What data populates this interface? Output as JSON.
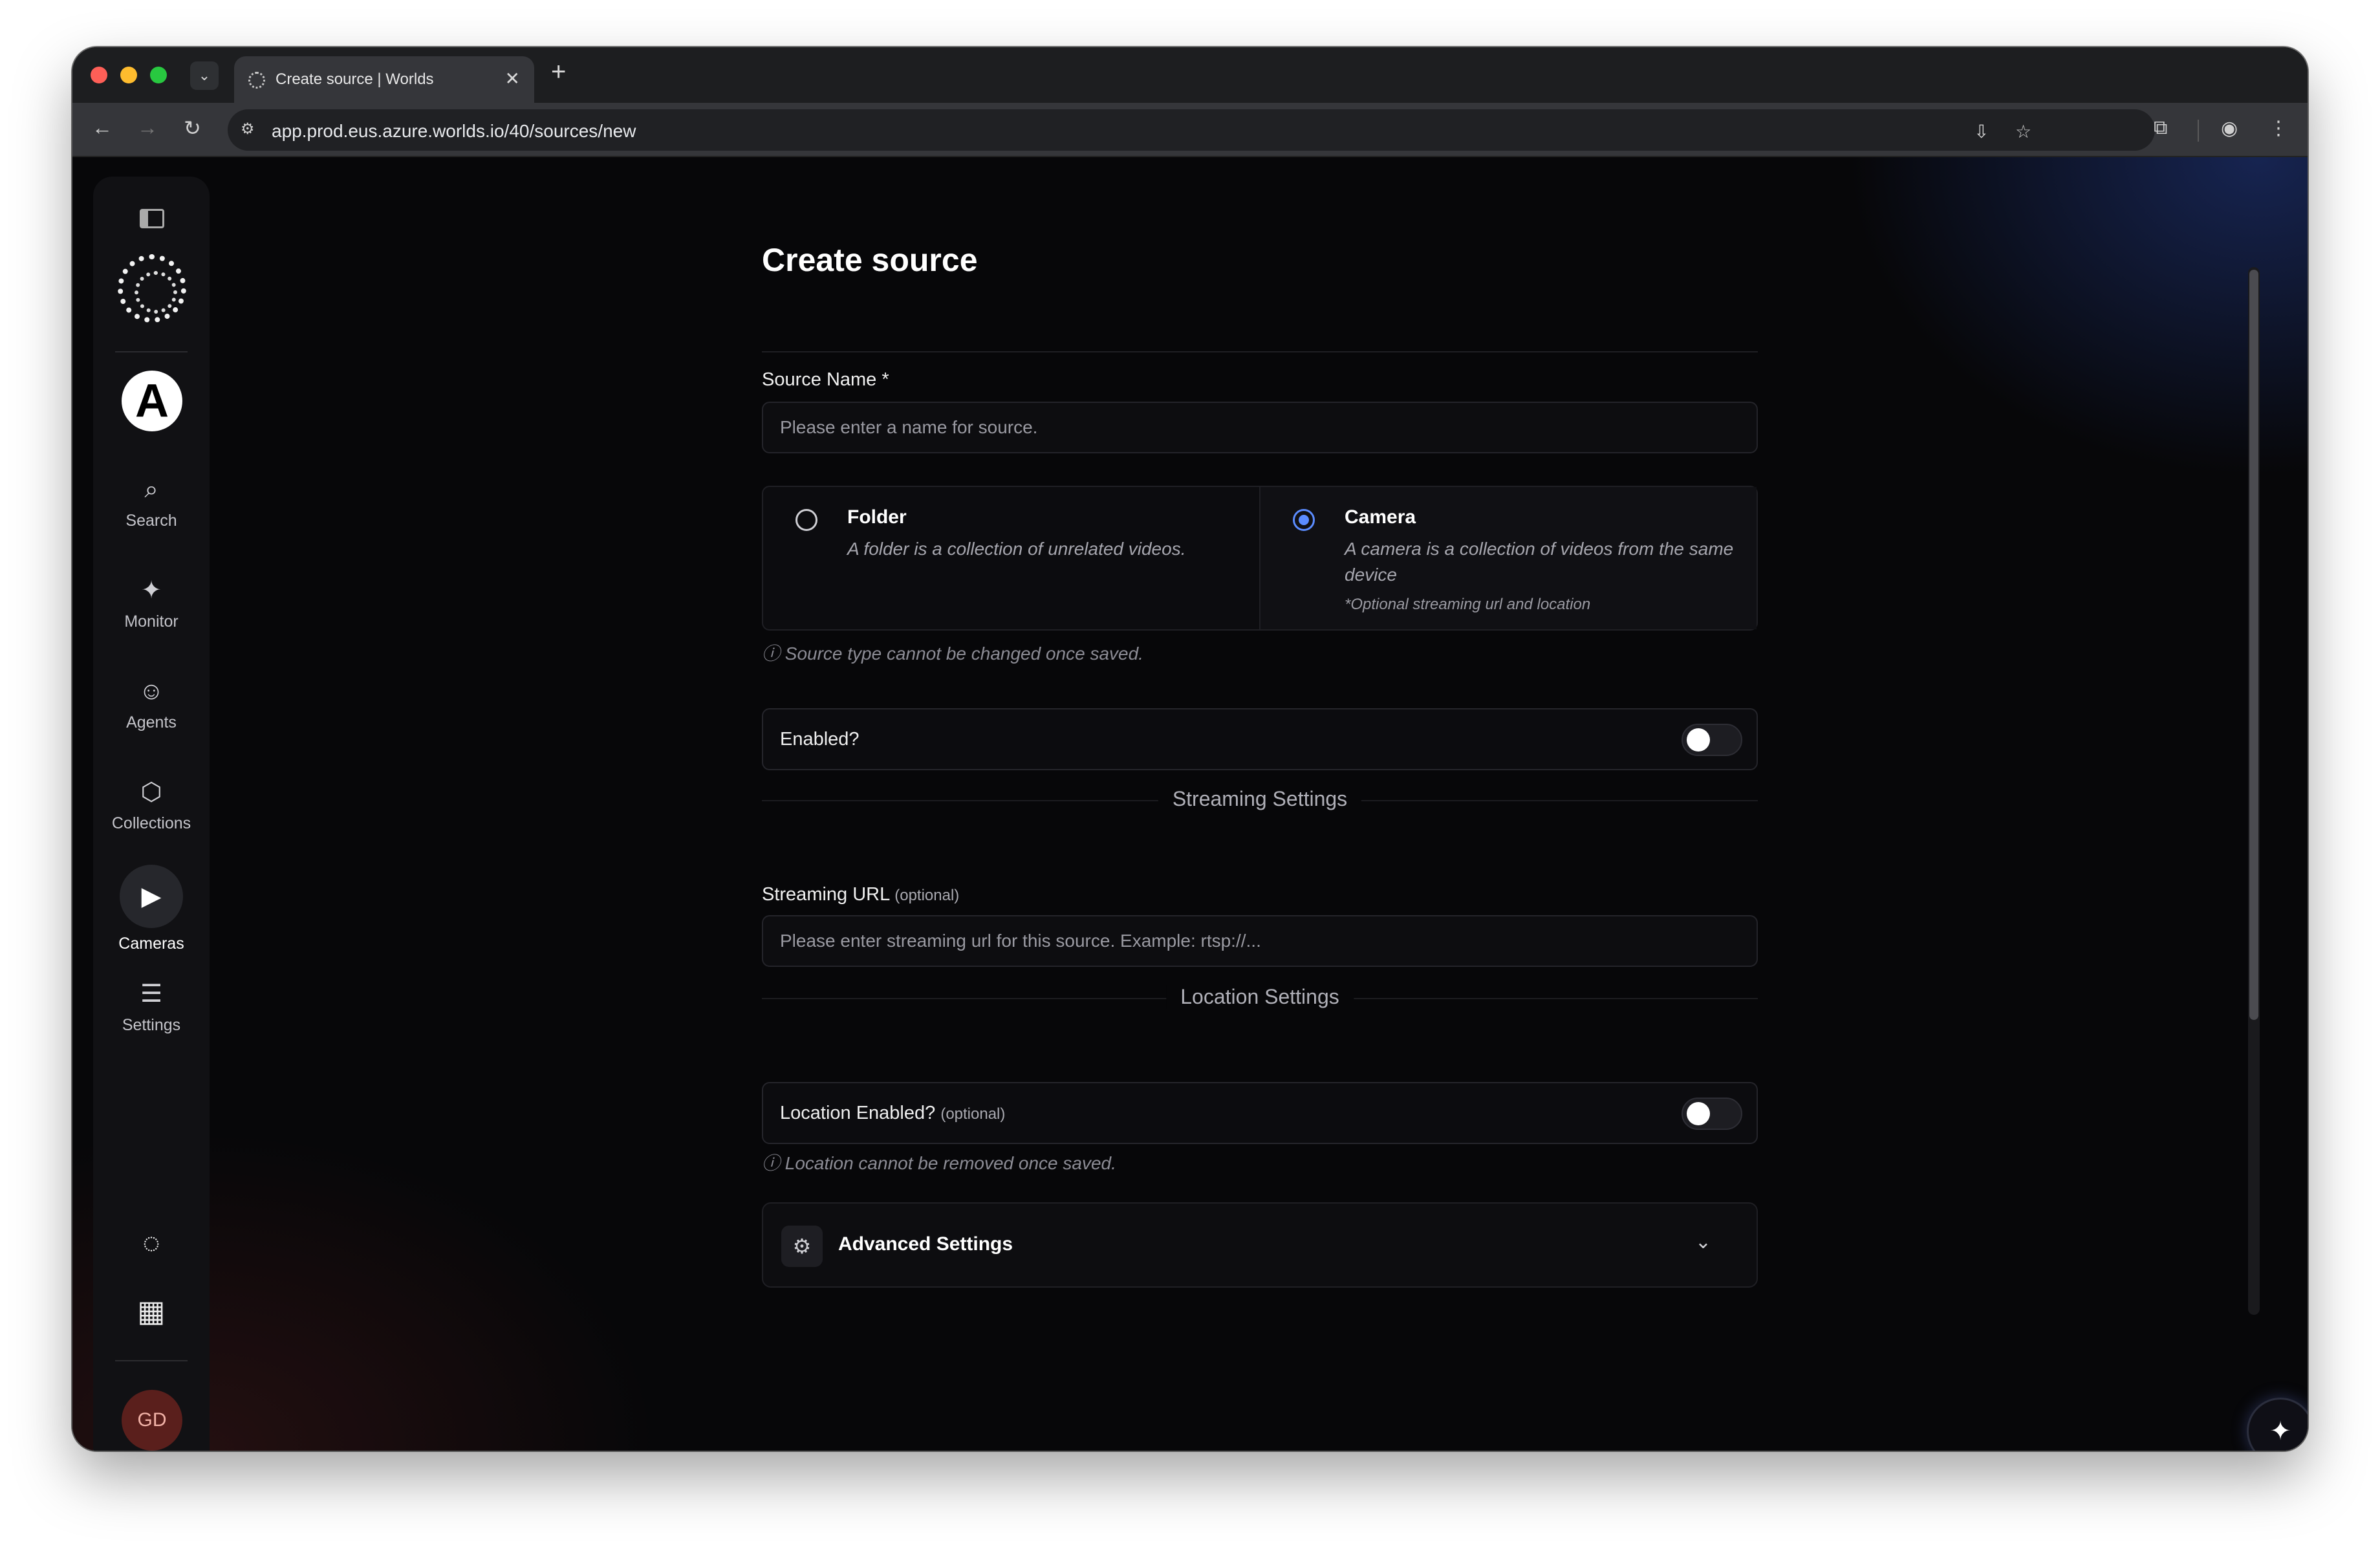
{
  "browser": {
    "tab_title": "Create source | Worlds",
    "tab_close_glyph": "✕",
    "new_tab_glyph": "+",
    "url": "app.prod.eus.azure.worlds.io/40/sources/new",
    "icons": {
      "back": "←",
      "forward": "→",
      "reload": "↻",
      "site_info": "⚙",
      "install": "⇩",
      "bookmark": "☆",
      "extensions": "⧉",
      "profile": "◉",
      "menu": "⋮",
      "tab_search": "⌄"
    }
  },
  "sidebar": {
    "org_initial": "A",
    "items": [
      {
        "label": "Search",
        "icon": "⌕"
      },
      {
        "label": "Monitor",
        "icon": "✦"
      },
      {
        "label": "Agents",
        "icon": "☺"
      },
      {
        "label": "Collections",
        "icon": "⬡"
      },
      {
        "label": "Cameras",
        "icon": "▶"
      },
      {
        "label": "Settings",
        "icon": "☰"
      }
    ],
    "bottom_icons": {
      "loading": "◌",
      "building": "▦"
    },
    "avatar_initials": "GD"
  },
  "form": {
    "title": "Create source",
    "source_name": {
      "label": "Source Name *",
      "placeholder": "Please enter a name for source.",
      "value": ""
    },
    "source_type": {
      "options": [
        {
          "title": "Folder",
          "description": "A folder is a collection of unrelated videos.",
          "note": "",
          "selected": false
        },
        {
          "title": "Camera",
          "description": "A camera is a collection of videos from the same device",
          "note": "*Optional streaming url and location",
          "selected": true
        }
      ],
      "hint": "ⓘ Source type cannot be changed once saved."
    },
    "enabled": {
      "label": "Enabled?",
      "on": false
    },
    "streaming_section": "Streaming Settings",
    "streaming_url": {
      "label": "Streaming URL",
      "optional": "(optional)",
      "placeholder": "Please enter streaming url for this source. Example: rtsp://...",
      "value": ""
    },
    "location_section": "Location Settings",
    "location_enabled": {
      "label": "Location Enabled?",
      "optional": "(optional)",
      "on": false
    },
    "location_hint": "ⓘ Location cannot be removed once saved.",
    "advanced": {
      "label": "Advanced Settings",
      "icon": "⚙",
      "chevron": "⌄"
    }
  },
  "assistant_icon": "✦",
  "colors": {
    "accent": "#5b8cff",
    "background": "#070709",
    "avatar_bg": "#5a1f1c"
  }
}
